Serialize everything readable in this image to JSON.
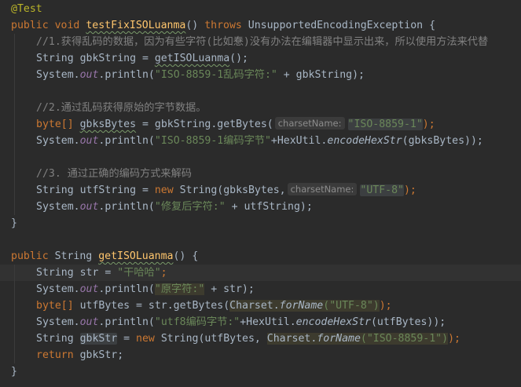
{
  "editor": {
    "annotation": "@Test",
    "method1": {
      "kw_public": "public",
      "kw_void": "void",
      "name": "testFixISOLuanma",
      "parens": "()",
      "kw_throws": "throws",
      "exception": "UnsupportedEncodingException",
      "brace_open": "{",
      "comment1": "//1.获得乱码的数据，因为有些字符(比如惷)没有办法在编辑器中显示出来，所以使用方法来代替",
      "l4_pre": "String gbkString = ",
      "l4_call": "getISOLuanma",
      "l4_post": "();",
      "l5_pre": "System.",
      "l5_out": "out",
      "l5_mid": ".println(",
      "l5_str": "\"ISO-8859-1乱码字符:\"",
      "l5_post": " + gbkString);",
      "comment2": "//2.通过乱码获得原始的字节数据。",
      "l8_kw": "byte[]",
      "l8_var": "gbksBytes",
      "l8_mid": " = gbkString.getBytes(",
      "l8_hint": "charsetName:",
      "l8_str": "\"ISO-8859-1\"",
      "l8_post": ");",
      "l9_pre": "System.",
      "l9_out": "out",
      "l9_mid": ".println(",
      "l9_str": "\"ISO-8859-1编码字节\"",
      "l9_mid2": "+HexUtil.",
      "l9_call": "encodeHexStr",
      "l9_post": "(gbksBytes));",
      "comment3": "//3. 通过正确的编码方式来解码",
      "l12_pre": "String utfString = ",
      "l12_kw": "new",
      "l12_mid": " String(gbksBytes,",
      "l12_hint": "charsetName:",
      "l12_str": "\"UTF-8\"",
      "l12_post": ");",
      "l13_pre": "System.",
      "l13_out": "out",
      "l13_mid": ".println(",
      "l13_str": "\"修复后字符:\"",
      "l13_post": " + utfString);",
      "brace_close": "}"
    },
    "method2": {
      "kw_public": "public",
      "type": "String",
      "name": "getISOLuanma",
      "parens": "()",
      "brace_open": "{",
      "l18_pre": "String str = ",
      "l18_str": "\"干哈哈\"",
      "l18_post": ";",
      "l19_pre": "System.",
      "l19_out": "out",
      "l19_mid": ".println(",
      "l19_str": "\"原字符:\"",
      "l19_post": " + str);",
      "l20_kw": "byte[]",
      "l20_mid": " utfBytes = str.getBytes(",
      "l20_cls": "Charset.",
      "l20_call": "forName",
      "l20_str": "(\"UTF-8\")",
      "l20_post": ");",
      "l21_pre": "System.",
      "l21_out": "out",
      "l21_mid": ".println(",
      "l21_str": "\"utf8编码字节:\"",
      "l21_mid2": "+HexUtil.",
      "l21_call": "encodeHexStr",
      "l21_post": "(utfBytes));",
      "l22_pre": "String ",
      "l22_var": "gbkStr",
      "l22_mid": " = ",
      "l22_kw": "new",
      "l22_mid2": " String(utfBytes, ",
      "l22_cls": "Charset.",
      "l22_call": "forName",
      "l22_str": "(\"ISO-8859-1\")",
      "l22_post": ");",
      "l23_kw": "return",
      "l23_post": " gbkStr;",
      "brace_close": "}"
    }
  }
}
